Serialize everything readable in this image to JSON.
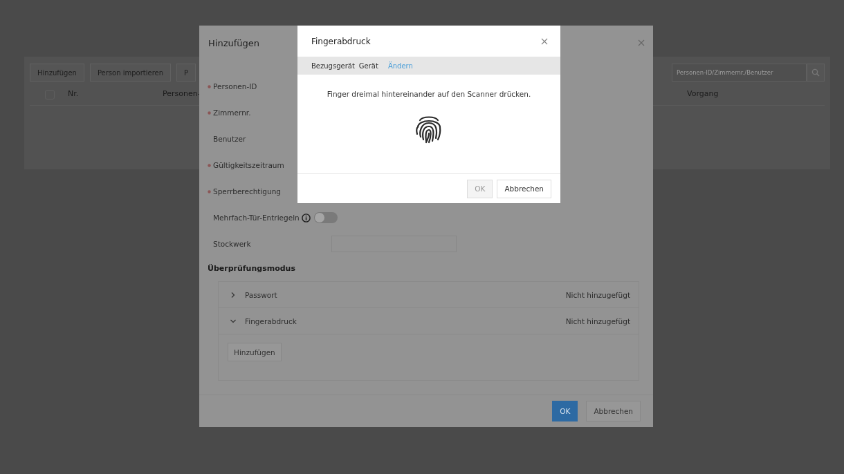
{
  "page": {
    "toolbar": [
      {
        "label": "Hinzufügen"
      },
      {
        "label": "Person importieren"
      },
      {
        "label": "P"
      }
    ],
    "search": {
      "placeholder": "Personen-ID/Zimmernr./Benutzer"
    },
    "table": {
      "select_all_checked": false,
      "columns": [
        "Nr.",
        "Personen-",
        "Vorgang"
      ]
    }
  },
  "add_dialog": {
    "title": "Hinzufügen",
    "form": [
      {
        "kind": "label",
        "label": "Personen-ID",
        "required": true
      },
      {
        "kind": "label",
        "label": "Zimmernr.",
        "required": true
      },
      {
        "kind": "label",
        "label": "Benutzer",
        "required": false
      },
      {
        "kind": "label",
        "label": "Gültigkeitszeitraum",
        "required": true
      },
      {
        "kind": "label",
        "label": "Sperrberechtigung",
        "required": true
      },
      {
        "kind": "toggle",
        "label": "Mehrfach-Tür-Entriegeln",
        "required": false,
        "on": false
      },
      {
        "kind": "input",
        "label": "Stockwerk",
        "required": false
      }
    ],
    "section_title": "Überprüfungsmodus",
    "modes": [
      {
        "label": "Passwort",
        "status": "Nicht hinzugefügt",
        "expanded": false
      },
      {
        "label": "Fingerabdruck",
        "status": "Nicht hinzugefügt",
        "expanded": true,
        "button": "Hinzufügen"
      }
    ],
    "buttons": [
      {
        "label": "OK",
        "primary": true
      },
      {
        "label": "Abbrechen",
        "primary": false
      }
    ]
  },
  "fingerprint_dialog": {
    "title": "Fingerabdruck",
    "device_label": "Bezugsgerät",
    "device": "Gerät",
    "change_link": "Ändern",
    "message": "Finger dreimal hintereinander auf den Scanner drücken.",
    "buttons": [
      {
        "label": "OK",
        "disabled": true
      },
      {
        "label": "Abbrechen",
        "disabled": false
      }
    ]
  }
}
